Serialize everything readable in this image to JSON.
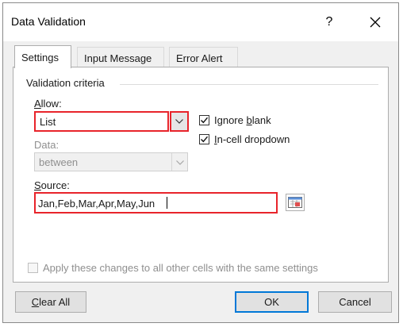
{
  "window": {
    "title": "Data Validation",
    "help_label": "?"
  },
  "tabs": [
    {
      "label": "Settings",
      "active": true
    },
    {
      "label": "Input Message",
      "active": false
    },
    {
      "label": "Error Alert",
      "active": false
    }
  ],
  "criteria": {
    "group_title": "Validation criteria",
    "allow": {
      "label_first": "A",
      "label_rest": "llow:",
      "value": "List"
    },
    "data": {
      "label": "Data:",
      "value": "between"
    },
    "source": {
      "label_first": "S",
      "label_rest": "ource:",
      "value": "Jan,Feb,Mar,Apr,May,Jun"
    },
    "ignore_blank": {
      "label_pre": "Ignore ",
      "label_u": "b",
      "label_post": "lank",
      "checked": true
    },
    "incell_dropdown": {
      "label_u": "I",
      "label_post": "n-cell dropdown",
      "checked": true
    }
  },
  "apply_all": {
    "label": "Apply these changes to all other cells with the same settings",
    "checked": false
  },
  "buttons": {
    "clear_all": {
      "label_u": "C",
      "label_rest": "lear All"
    },
    "ok": "OK",
    "cancel": "Cancel"
  },
  "colors": {
    "highlight": "#e8242b",
    "accent": "#0078d7"
  },
  "icons": {
    "close": "close-icon",
    "dropdown": "chevron-down-icon",
    "range_picker": "range-selector-icon",
    "check": "checkmark-icon"
  }
}
